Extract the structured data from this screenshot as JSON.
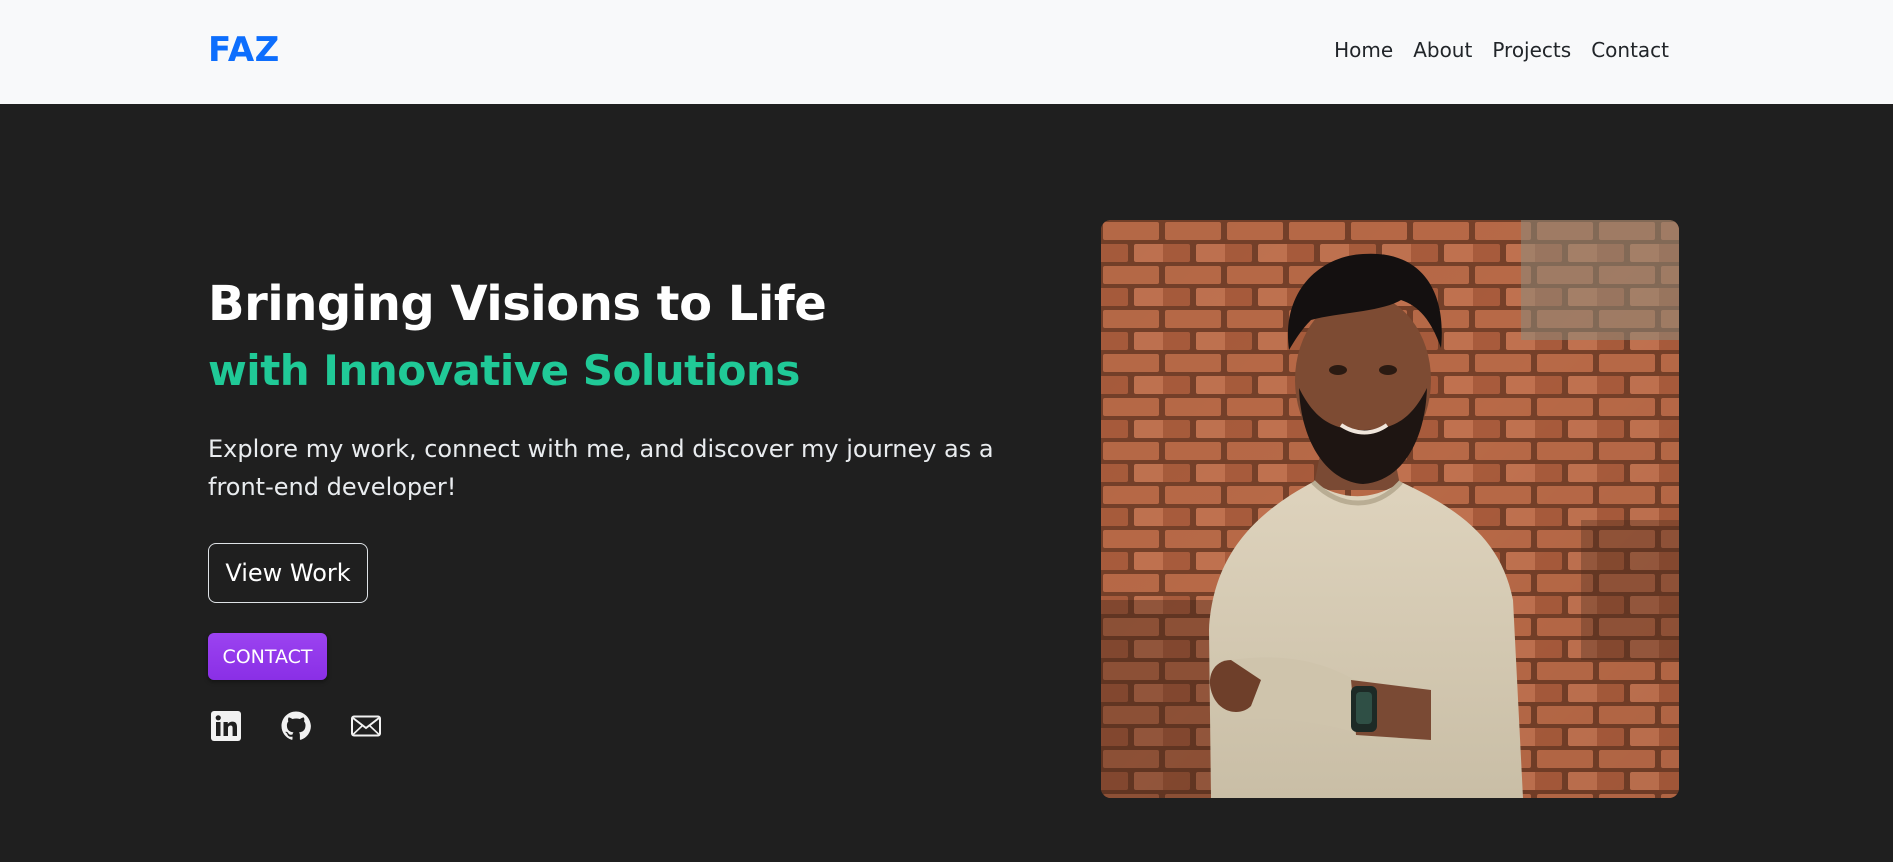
{
  "navbar": {
    "brand": "FAZ",
    "links": [
      "Home",
      "About",
      "Projects",
      "Contact"
    ]
  },
  "hero": {
    "headline": "Bringing Visions to Life",
    "subheadline": "with Innovative Solutions",
    "intro": "Explore my work, connect with me, and discover my journey as a front-end developer!",
    "view_work_label": "View Work",
    "contact_label": "CONTACT",
    "socials": [
      "linkedin-icon",
      "github-icon",
      "envelope-icon"
    ],
    "photo": "profile-photo"
  },
  "colors": {
    "brand": "#0d6efd",
    "accent_green": "#20c997",
    "contact_purple": "#8a2fe6",
    "hero_bg": "#1f1f1f",
    "nav_bg": "#f8f9fa"
  }
}
